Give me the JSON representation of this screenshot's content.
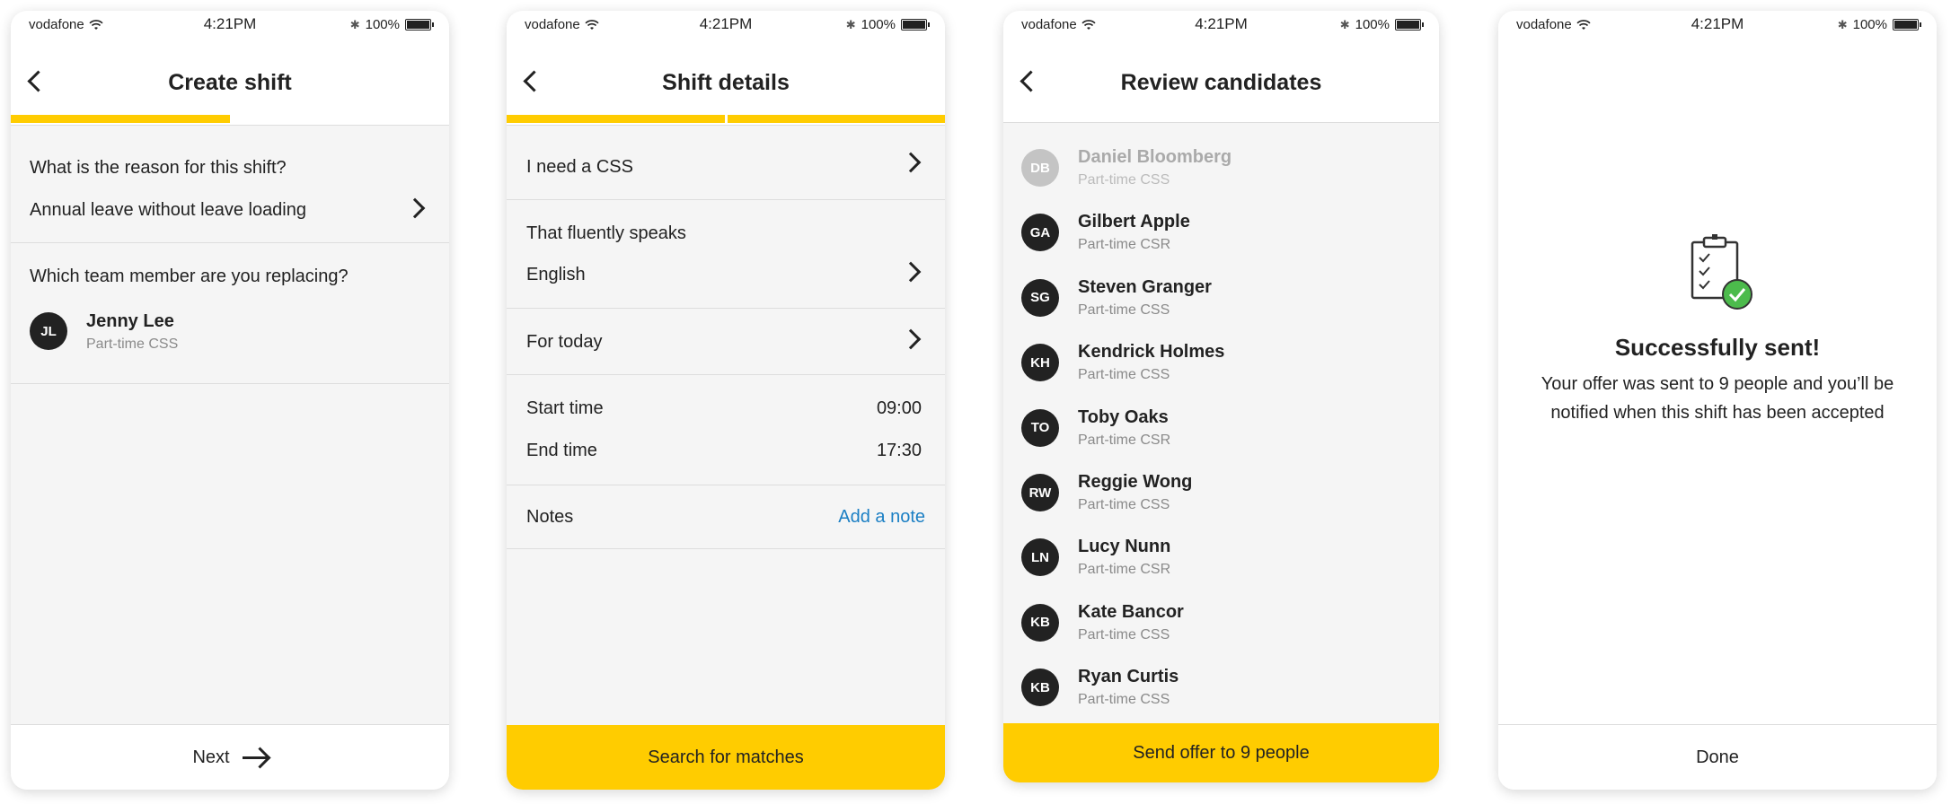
{
  "status_bar": {
    "carrier": "vodafone",
    "time": "4:21PM",
    "battery": "100%"
  },
  "screen1": {
    "title": "Create shift",
    "progress": 0.5,
    "reason_label": "What is the reason for this shift?",
    "reason_value": "Annual leave without leave loading",
    "replacing_label": "Which team member are you replacing?",
    "member": {
      "initials": "JL",
      "name": "Jenny Lee",
      "role": "Part-time CSS"
    },
    "next_label": "Next"
  },
  "screen2": {
    "title": "Shift details",
    "progress": 1.0,
    "need": "I need a CSS",
    "speaks_label": "That fluently speaks",
    "speaks_value": "English",
    "when": "For today",
    "start_label": "Start time",
    "start_value": "09:00",
    "end_label": "End time",
    "end_value": "17:30",
    "notes_label": "Notes",
    "notes_link": "Add a note",
    "action_label": "Search for matches"
  },
  "screen3": {
    "title": "Review candidates",
    "candidates": [
      {
        "initials": "DB",
        "name": "Daniel Bloomberg",
        "role": "Part-time CSS",
        "disabled": true
      },
      {
        "initials": "GA",
        "name": "Gilbert Apple",
        "role": "Part-time CSR"
      },
      {
        "initials": "SG",
        "name": "Steven Granger",
        "role": "Part-time CSS"
      },
      {
        "initials": "KH",
        "name": "Kendrick Holmes",
        "role": "Part-time CSS"
      },
      {
        "initials": "TO",
        "name": "Toby Oaks",
        "role": "Part-time CSR"
      },
      {
        "initials": "RW",
        "name": "Reggie Wong",
        "role": "Part-time CSS"
      },
      {
        "initials": "LN",
        "name": "Lucy Nunn",
        "role": "Part-time CSR"
      },
      {
        "initials": "KB",
        "name": "Kate Bancor",
        "role": "Part-time CSS"
      },
      {
        "initials": "KB",
        "name": "Ryan Curtis",
        "role": "Part-time CSS"
      }
    ],
    "action_label": "Send offer to 9 people"
  },
  "screen4": {
    "heading": "Successfully sent!",
    "message_line1": "Your offer was sent to 9 people and you’ll be",
    "message_line2": "notified when this shift has been accepted",
    "done_label": "Done"
  },
  "colors": {
    "accent": "#ffcc00",
    "link": "#1b7fc4",
    "success": "#4cbb4c"
  },
  "icons": [
    "back-chevron-icon",
    "chevron-right-icon",
    "arrow-right-icon",
    "wifi-icon",
    "bluetooth-icon",
    "battery-icon",
    "clipboard-check-icon"
  ]
}
